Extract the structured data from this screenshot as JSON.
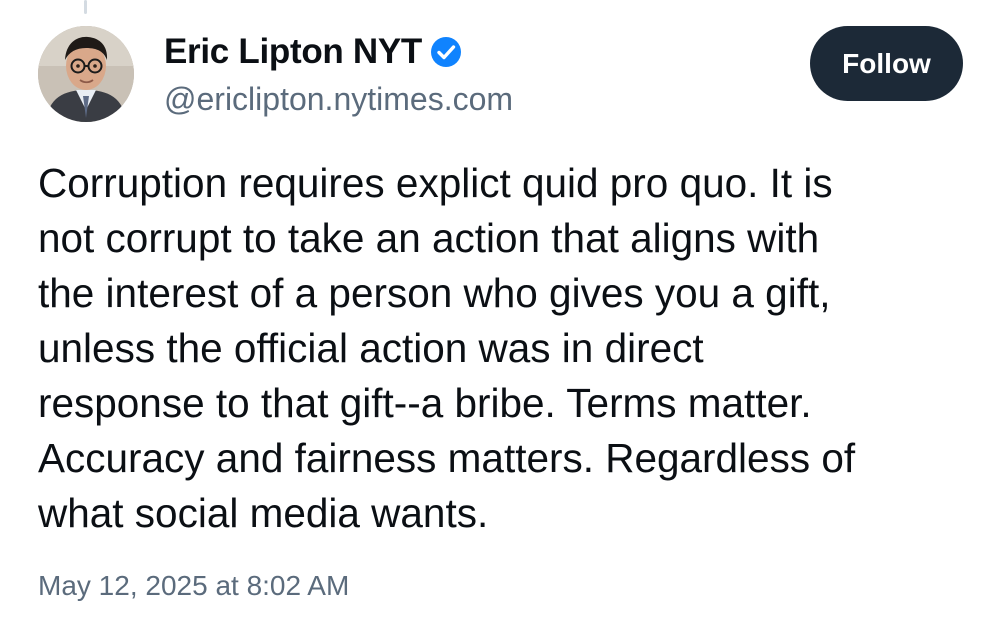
{
  "author": {
    "display_name": "Eric Lipton NYT",
    "handle": "@ericlipton.nytimes.com",
    "verified_icon": "verified-check-icon",
    "verified_color": "#1083fe"
  },
  "follow_button": {
    "label": "Follow",
    "background": "#1c2937"
  },
  "post": {
    "lines": [
      "Corruption requires explict quid pro quo. It is",
      "not corrupt to take an action that aligns with",
      "the interest of a person who gives you a gift,",
      "unless the official action was in direct",
      "response to that gift--a bribe. Terms matter.",
      "Accuracy and fairness matters. Regardless of",
      "what social media wants."
    ],
    "timestamp": "May 12, 2025 at 8:02 AM"
  }
}
